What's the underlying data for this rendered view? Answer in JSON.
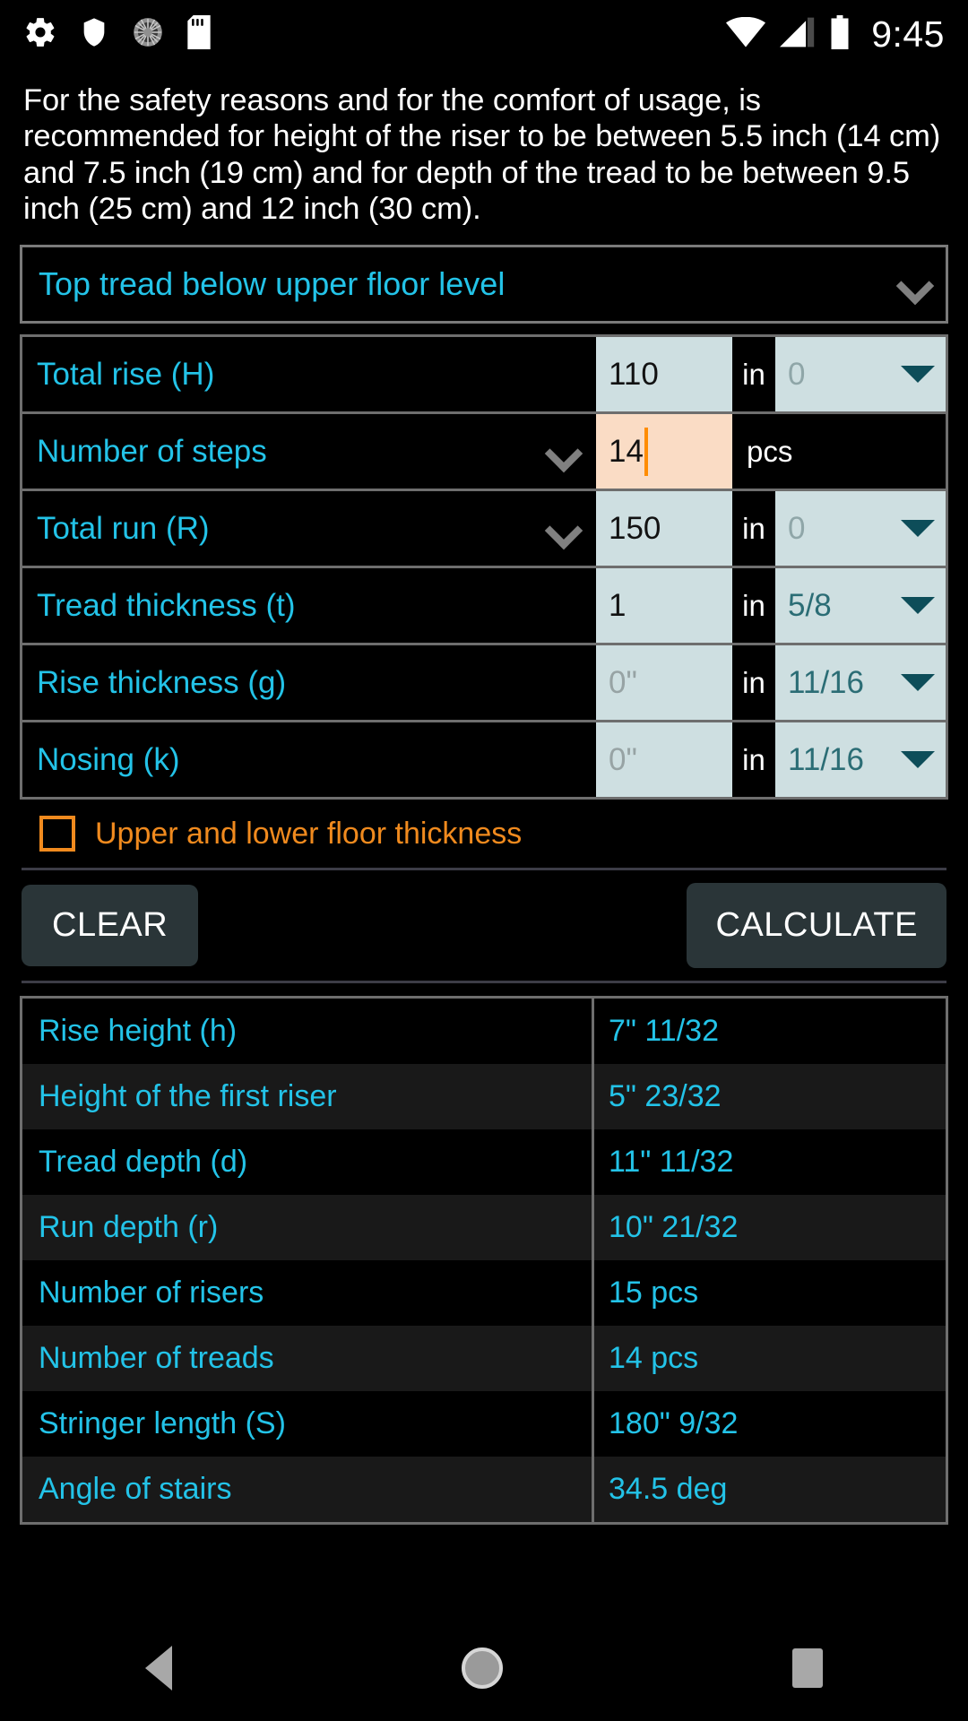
{
  "statusbar": {
    "icons": [
      "gear-icon",
      "shield-icon",
      "spinner-icon",
      "sd-card-icon"
    ],
    "right_icons": [
      "wifi-icon",
      "signal-icon",
      "battery-icon"
    ],
    "time": "9:45"
  },
  "intro": {
    "text": "For the safety reasons and for the comfort of usage, is recommended for height of the riser to be between 5.5 inch (14 cm) and 7.5 inch (19 cm) and for depth of the tread to be between 9.5 inch (25 cm) and 12 inch (30 cm)."
  },
  "spinner": {
    "selected": "Top tread below upper floor level",
    "icon": "chevron-down-icon"
  },
  "inputs": {
    "rows": [
      {
        "label": "Total rise (H)",
        "has_chevron": false,
        "value": "110",
        "value_is_placeholder": false,
        "focused": false,
        "unit": "in",
        "fraction": "0",
        "fraction_is_placeholder": true,
        "has_fraction": true
      },
      {
        "label": "Number of steps",
        "has_chevron": true,
        "value": "14",
        "value_is_placeholder": false,
        "focused": true,
        "unit": "pcs",
        "fraction": "",
        "fraction_is_placeholder": false,
        "has_fraction": false
      },
      {
        "label": "Total run (R)",
        "has_chevron": true,
        "value": "150",
        "value_is_placeholder": false,
        "focused": false,
        "unit": "in",
        "fraction": "0",
        "fraction_is_placeholder": true,
        "has_fraction": true
      },
      {
        "label": "Tread thickness (t)",
        "has_chevron": false,
        "value": "1",
        "value_is_placeholder": false,
        "focused": false,
        "unit": "in",
        "fraction": "5/8",
        "fraction_is_placeholder": false,
        "has_fraction": true
      },
      {
        "label": "Rise thickness (g)",
        "has_chevron": false,
        "value": "0\"",
        "value_is_placeholder": true,
        "focused": false,
        "unit": "in",
        "fraction": "11/16",
        "fraction_is_placeholder": false,
        "has_fraction": true
      },
      {
        "label": "Nosing (k)",
        "has_chevron": false,
        "value": "0\"",
        "value_is_placeholder": true,
        "focused": false,
        "unit": "in",
        "fraction": "11/16",
        "fraction_is_placeholder": false,
        "has_fraction": true
      }
    ]
  },
  "checkbox": {
    "label": "Upper and lower floor thickness",
    "checked": false,
    "color": "#f08a1e"
  },
  "buttons": {
    "clear": "CLEAR",
    "calculate": "CALCULATE"
  },
  "results": {
    "rows": [
      {
        "label": "Rise height (h)",
        "value": "7\" 11/32"
      },
      {
        "label": "Height of the first riser",
        "value": "5\" 23/32"
      },
      {
        "label": "Tread depth (d)",
        "value": "11\" 11/32"
      },
      {
        "label": "Run depth (r)",
        "value": "10\" 21/32"
      },
      {
        "label": "Number of risers",
        "value": "15 pcs"
      },
      {
        "label": "Number of treads",
        "value": "14 pcs"
      },
      {
        "label": "Stringer length (S)",
        "value": "180\" 9/32"
      },
      {
        "label": "Angle of stairs",
        "value": "34.5 deg"
      }
    ]
  },
  "navbar": {
    "back": "back-icon",
    "home": "home-icon",
    "recents": "recents-icon"
  },
  "colors": {
    "accent_cyan": "#23c3e8",
    "accent_orange": "#f08a1e",
    "field_bg": "#cedfe1",
    "field_focus_bg": "#fadcc5",
    "background": "#000000"
  }
}
